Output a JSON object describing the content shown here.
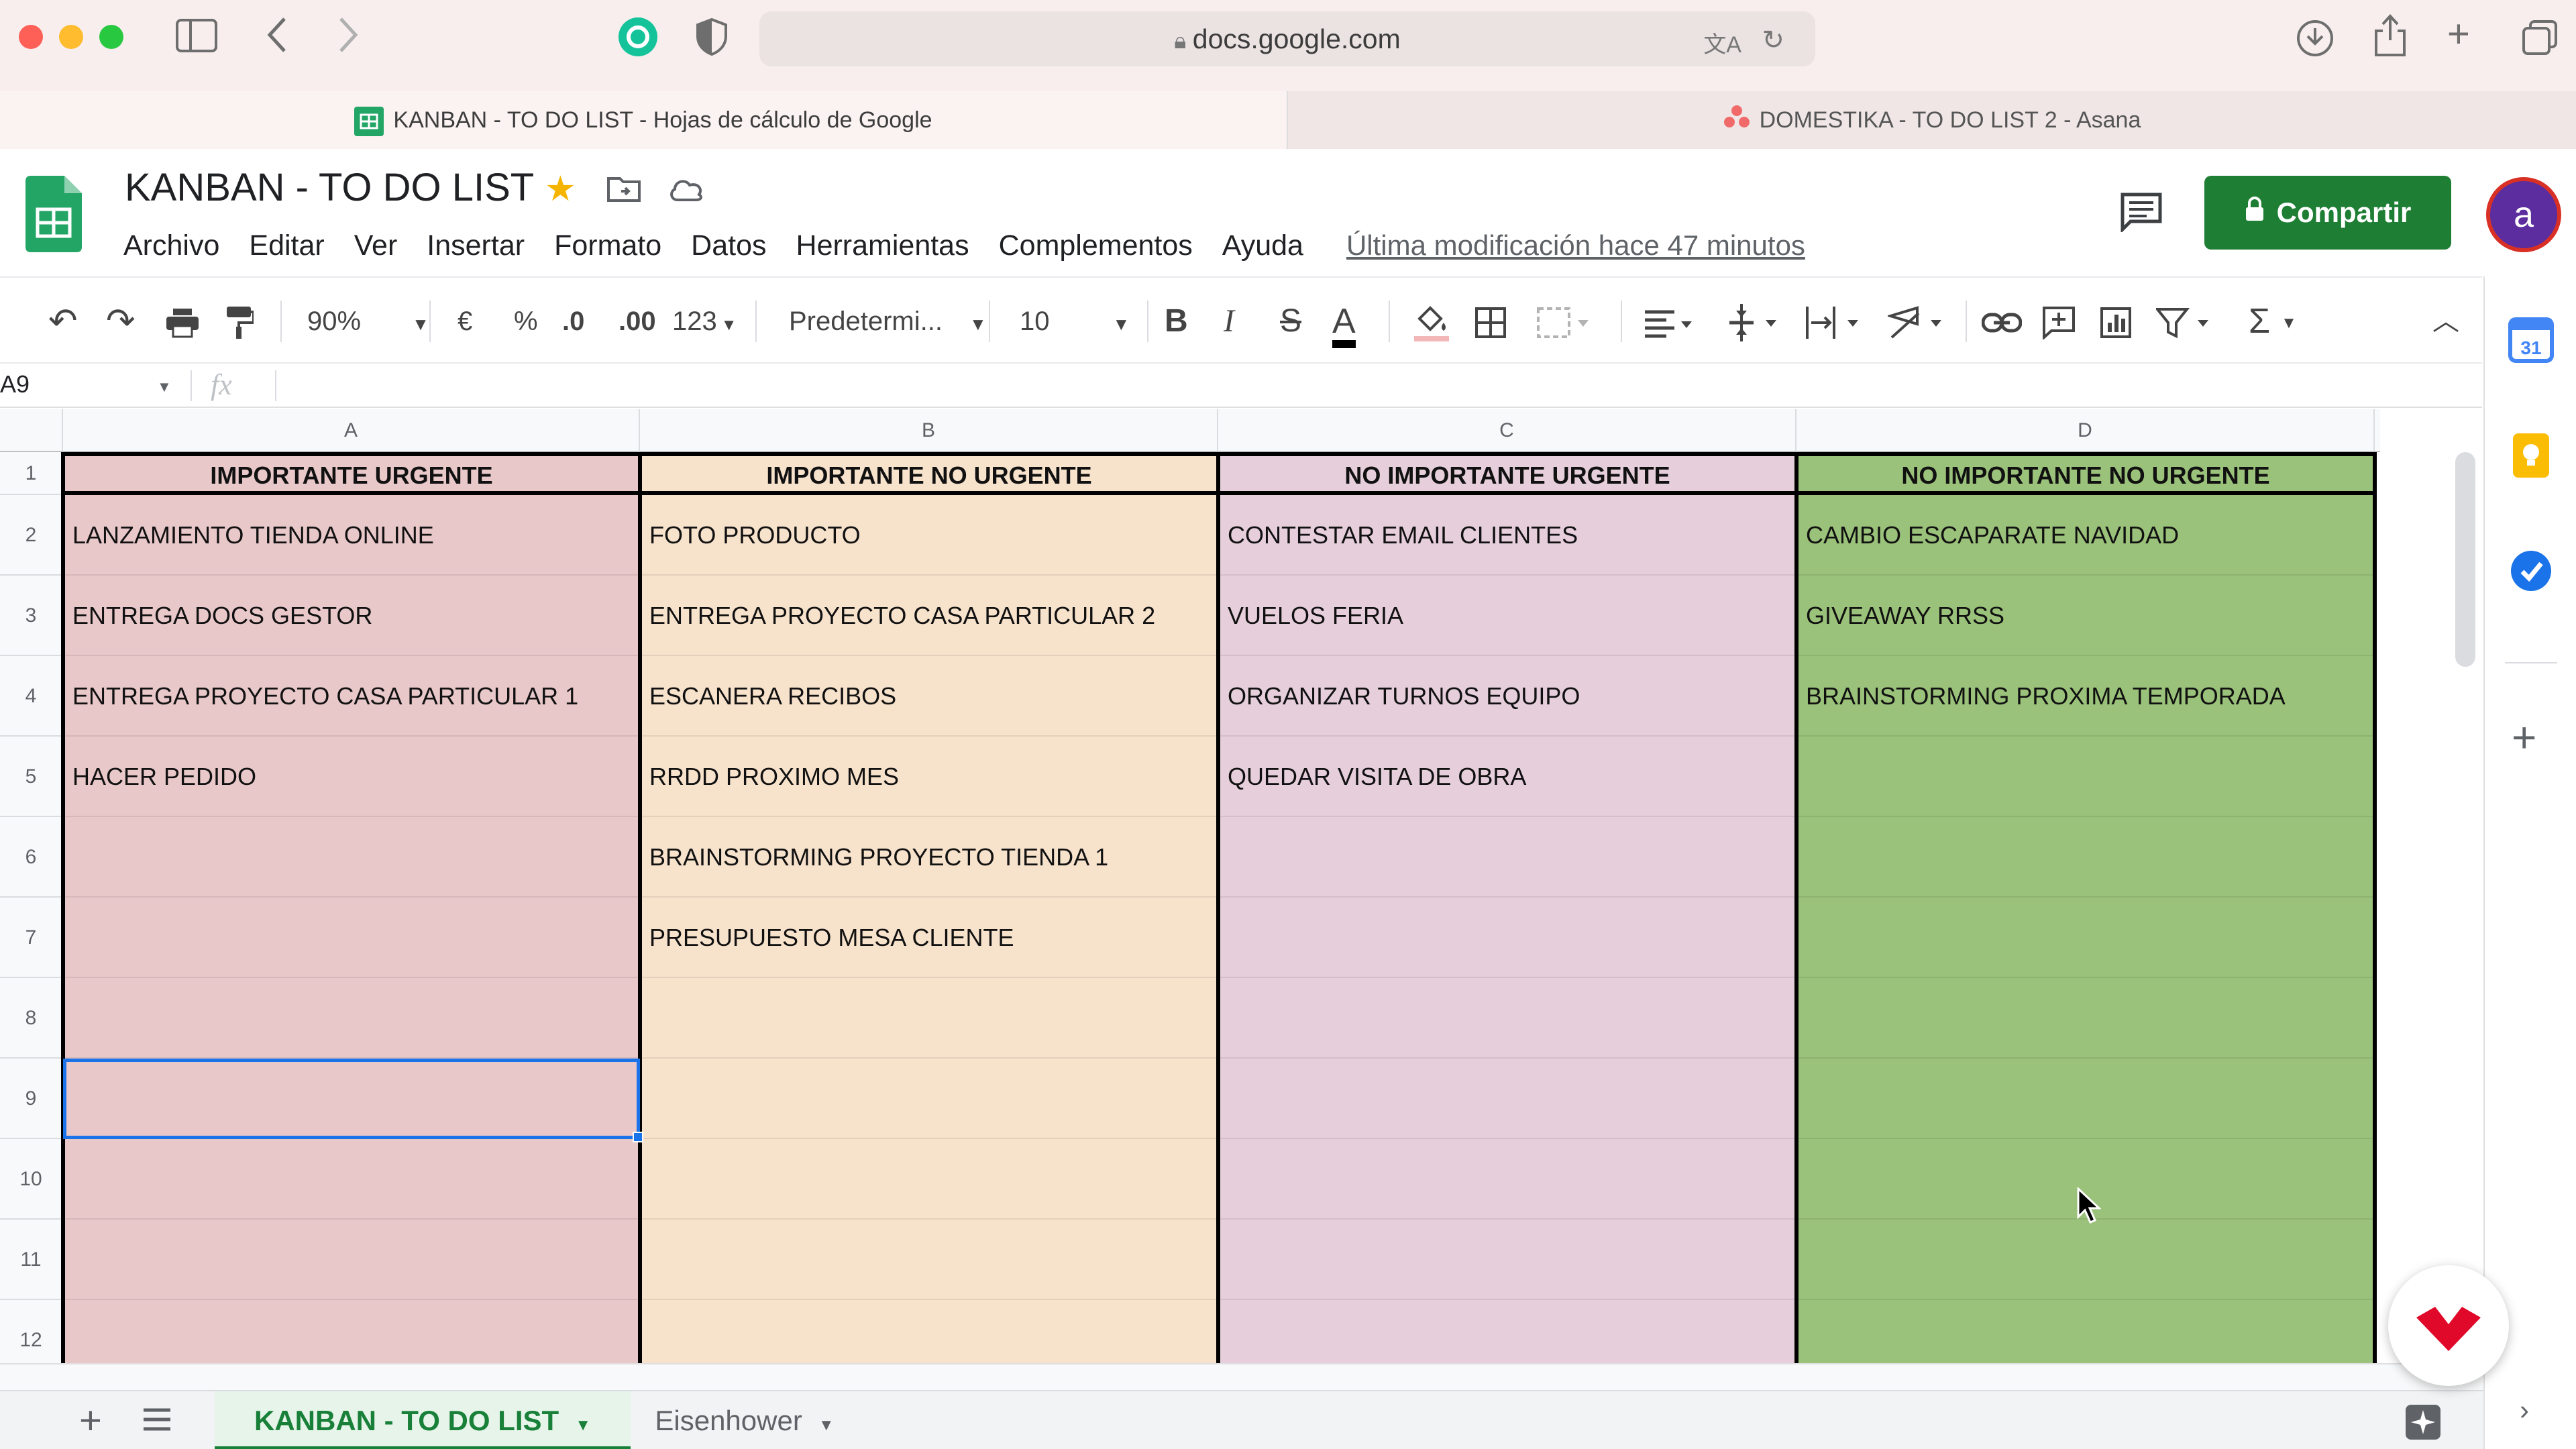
{
  "browser": {
    "url": "docs.google.com",
    "tabs": [
      {
        "label": "KANBAN - TO DO LIST - Hojas de cálculo de Google"
      },
      {
        "label": "DOMESTIKA - TO DO LIST 2 - Asana"
      }
    ]
  },
  "app": {
    "doc_title": "KANBAN - TO DO LIST",
    "menu": [
      "Archivo",
      "Editar",
      "Ver",
      "Insertar",
      "Formato",
      "Datos",
      "Herramientas",
      "Complementos",
      "Ayuda"
    ],
    "last_edit": "Última modificación hace 47 minutos",
    "share_label": "Compartir",
    "avatar_letter": "a"
  },
  "toolbar": {
    "zoom": "90%",
    "currency": "€",
    "percent": "%",
    "dec_less": ".0",
    "dec_more": ".00",
    "format_more": "123",
    "font": "Predetermi...",
    "font_size": "10",
    "bold": "B",
    "italic": "I",
    "strike": "S",
    "text_color": "A"
  },
  "formula_bar": {
    "cell_ref": "A9",
    "fx": "fx"
  },
  "grid": {
    "column_headers": [
      "A",
      "B",
      "C",
      "D"
    ],
    "row_numbers": [
      "1",
      "2",
      "3",
      "4",
      "5",
      "6",
      "7",
      "8",
      "9",
      "10",
      "11",
      "12"
    ],
    "selected_cell": "A9",
    "columns": [
      {
        "header": "IMPORTANTE URGENTE",
        "items": [
          "LANZAMIENTO TIENDA ONLINE",
          "ENTREGA DOCS GESTOR",
          "ENTREGA PROYECTO CASA PARTICULAR 1",
          "HACER PEDIDO",
          "",
          "",
          "",
          "",
          "",
          "",
          ""
        ]
      },
      {
        "header": "IMPORTANTE NO URGENTE",
        "items": [
          "FOTO PRODUCTO",
          "ENTREGA PROYECTO CASA PARTICULAR 2",
          "ESCANERA RECIBOS",
          "RRDD PROXIMO MES",
          "BRAINSTORMING PROYECTO TIENDA 1",
          "PRESUPUESTO MESA CLIENTE",
          "",
          "",
          "",
          "",
          ""
        ]
      },
      {
        "header": "NO IMPORTANTE URGENTE",
        "items": [
          "CONTESTAR EMAIL CLIENTES",
          "VUELOS FERIA",
          "ORGANIZAR TURNOS EQUIPO",
          "QUEDAR VISITA DE OBRA",
          "",
          "",
          "",
          "",
          "",
          "",
          ""
        ]
      },
      {
        "header": "NO IMPORTANTE NO URGENTE",
        "items": [
          "CAMBIO ESCAPARATE NAVIDAD",
          "GIVEAWAY RRSS",
          "BRAINSTORMING PROXIMA TEMPORADA",
          "",
          "",
          "",
          "",
          "",
          "",
          "",
          ""
        ]
      }
    ]
  },
  "sheets": {
    "tabs": [
      {
        "label": "KANBAN - TO DO LIST",
        "active": true
      },
      {
        "label": "Eisenhower",
        "active": false
      }
    ]
  },
  "colors": {
    "colA": "#e9c8ca",
    "colB": "#f7e2cc",
    "colC": "#e6cfdb",
    "colD": "#9bc27a",
    "share": "#1e7e34",
    "selection": "#1a73e8"
  }
}
